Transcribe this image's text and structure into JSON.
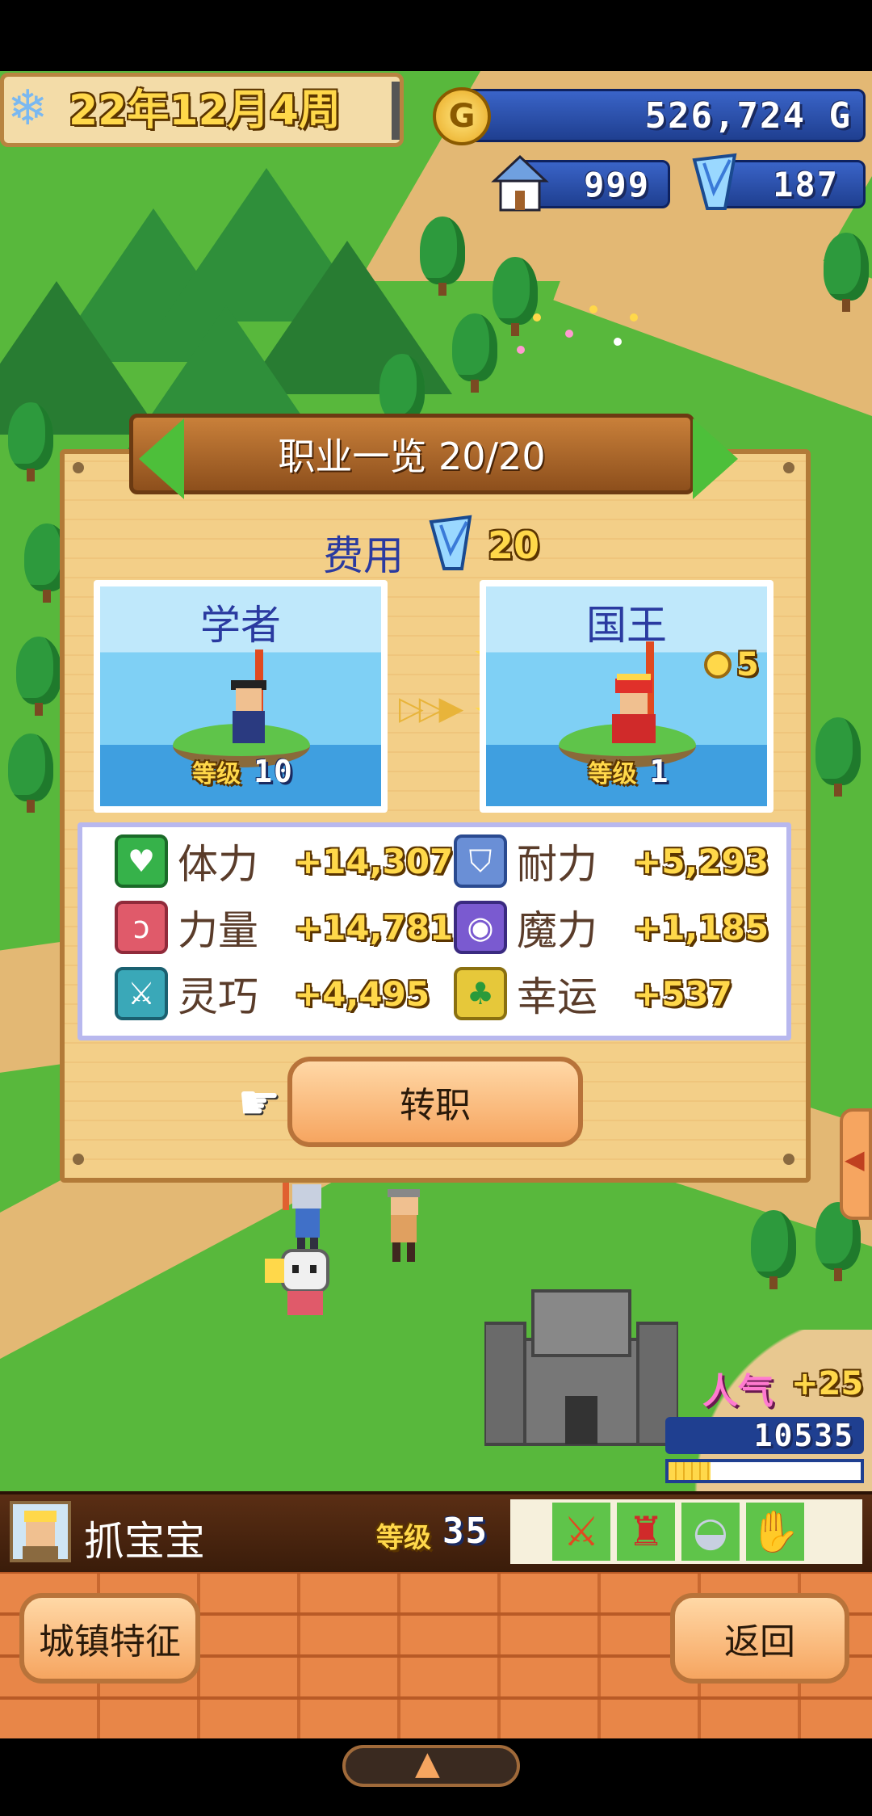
{
  "hud": {
    "date": "22年12月4周",
    "gold": "526,724 G",
    "houses": "999",
    "gems": "187"
  },
  "dialog": {
    "title": "职业一览 20/20",
    "cost_label": "费用",
    "cost_value": "20",
    "from_job": {
      "name": "学者",
      "level_label": "等级",
      "level": "10"
    },
    "to_job": {
      "name": "国王",
      "level_label": "等级",
      "level": "1",
      "medal": "5"
    },
    "stats": [
      {
        "name": "体力",
        "value": "+14,307",
        "icon": "heart-icon",
        "color": "#36b24a"
      },
      {
        "name": "耐力",
        "value": "+5,293",
        "icon": "shield-icon",
        "color": "#6a8fd6"
      },
      {
        "name": "力量",
        "value": "+14,781",
        "icon": "arm-icon",
        "color": "#e05a6a"
      },
      {
        "name": "魔力",
        "value": "+1,185",
        "icon": "magic-orb-icon",
        "color": "#7a5ad0"
      },
      {
        "name": "灵巧",
        "value": "+4,495",
        "icon": "crossed-swords-icon",
        "color": "#3aa8b8"
      },
      {
        "name": "幸运",
        "value": "+537",
        "icon": "clover-icon",
        "color": "#e6c83a"
      }
    ],
    "action_button": "转职"
  },
  "popularity": {
    "label": "人气",
    "change": "+25",
    "value": "10535",
    "progress": 0.22
  },
  "player": {
    "name": "抓宝宝",
    "level_label": "等级",
    "level": "35"
  },
  "bottom": {
    "left_button": "城镇特征",
    "right_button": "返回"
  },
  "colors": {
    "accent_blue": "#2a3aa0",
    "button_fill": "#f6a560",
    "gold_text": "#ffd84a"
  }
}
